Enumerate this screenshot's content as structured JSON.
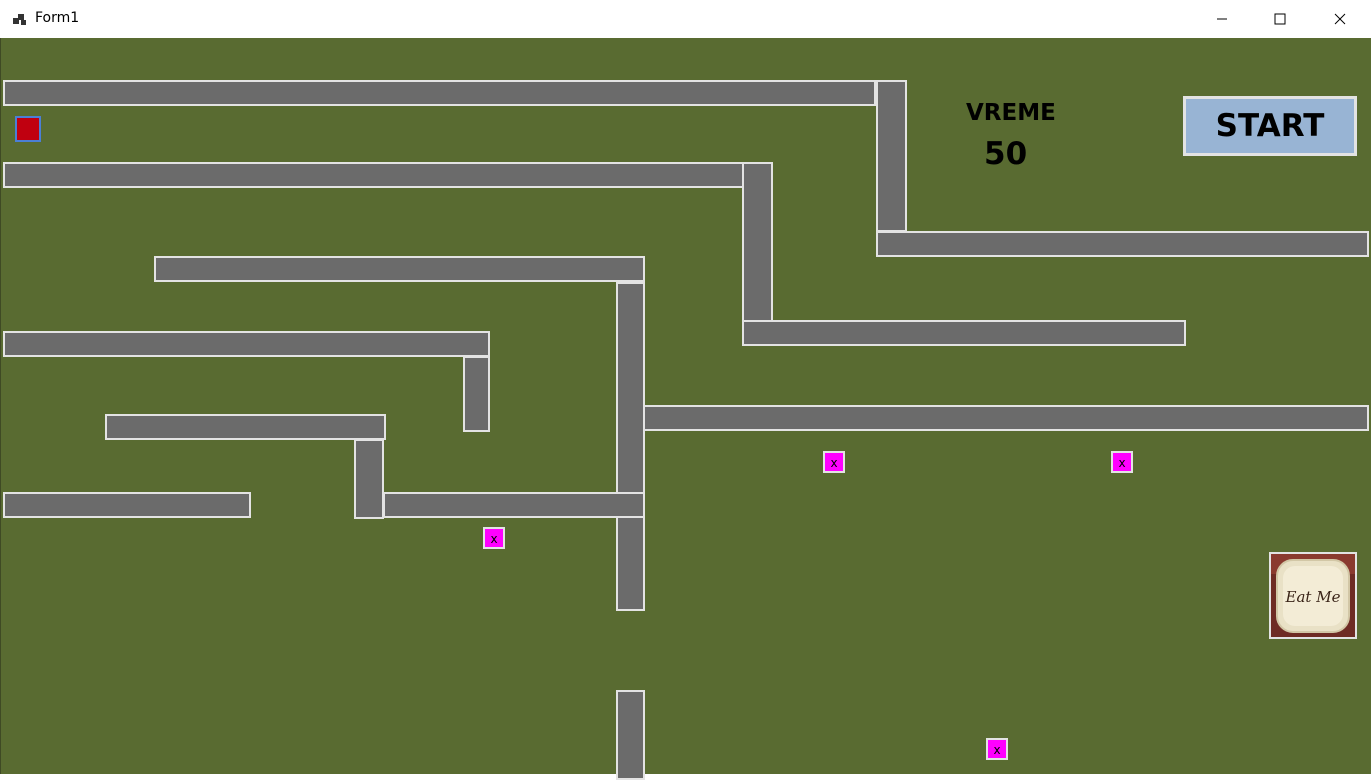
{
  "window": {
    "title": "Form1",
    "icons": {
      "app": "app-icon",
      "minimize": "minimize-icon",
      "maximize": "maximize-icon",
      "close": "close-icon"
    }
  },
  "hud": {
    "time_label": "VREME",
    "time_value": "50",
    "start_label": "START"
  },
  "mines": [
    {
      "label": "x"
    },
    {
      "label": "x"
    },
    {
      "label": "x"
    },
    {
      "label": "x"
    }
  ],
  "goal": {
    "icon": "cake-icon",
    "text": "Eat Me"
  },
  "colors": {
    "background": "#596b31",
    "wall": "#6b6b6b",
    "wall_border": "#e3e3e3",
    "player": "#c00010",
    "mine": "#ff00ff",
    "start_button": "#98b4d4"
  }
}
